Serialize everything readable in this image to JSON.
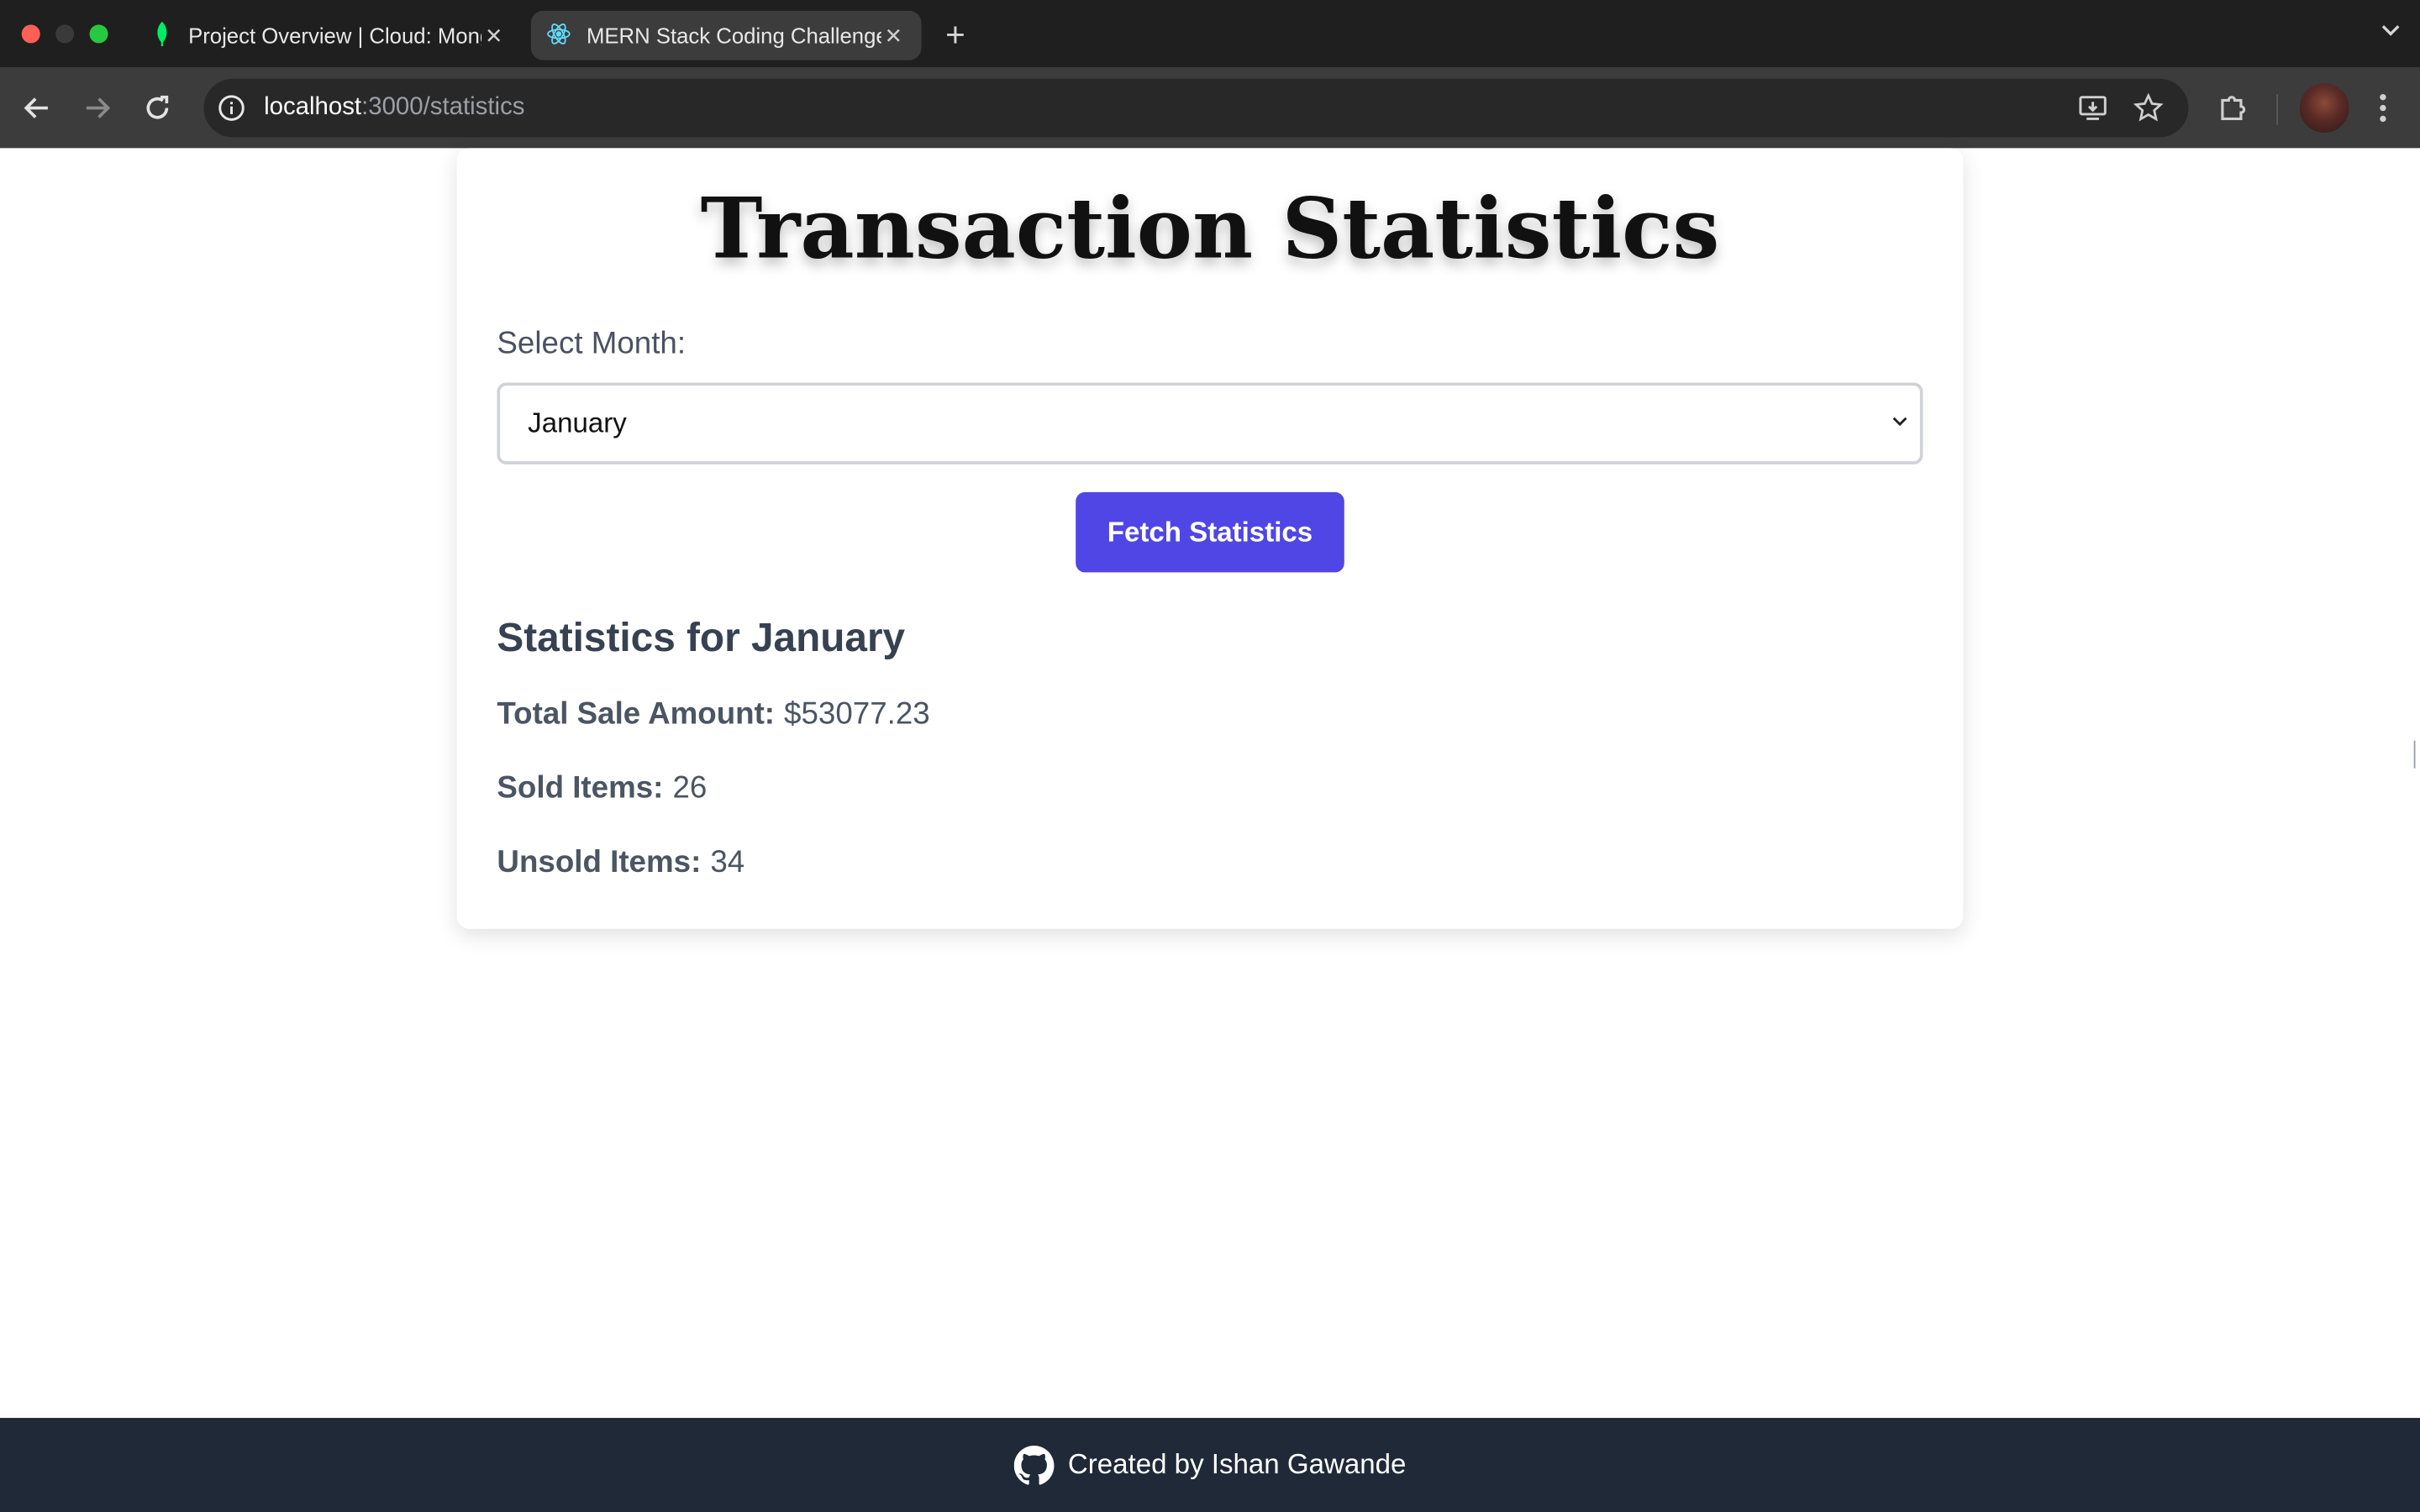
{
  "browser": {
    "tabs": [
      {
        "title": "Project Overview | Cloud: MongoDB Cloud",
        "icon": "mongodb-leaf-icon"
      },
      {
        "title": "MERN Stack Coding Challenge",
        "icon": "react-icon"
      }
    ],
    "address": {
      "host": "localhost",
      "path": ":3000/statistics"
    }
  },
  "page": {
    "title": "Transaction Statistics",
    "select_label": "Select Month:",
    "selected_month": "January",
    "button_label": "Fetch Statistics",
    "stats_heading": "Statistics for January",
    "stats": {
      "total_label": "Total Sale Amount:",
      "total_value": "$53077.23",
      "sold_label": "Sold Items:",
      "sold_value": "26",
      "unsold_label": "Unsold Items:",
      "unsold_value": "34"
    }
  },
  "footer": {
    "text": "Created by Ishan Gawande",
    "icon": "github-icon"
  },
  "colors": {
    "accent": "#4f46e5",
    "footer_bg": "#1f2937"
  }
}
